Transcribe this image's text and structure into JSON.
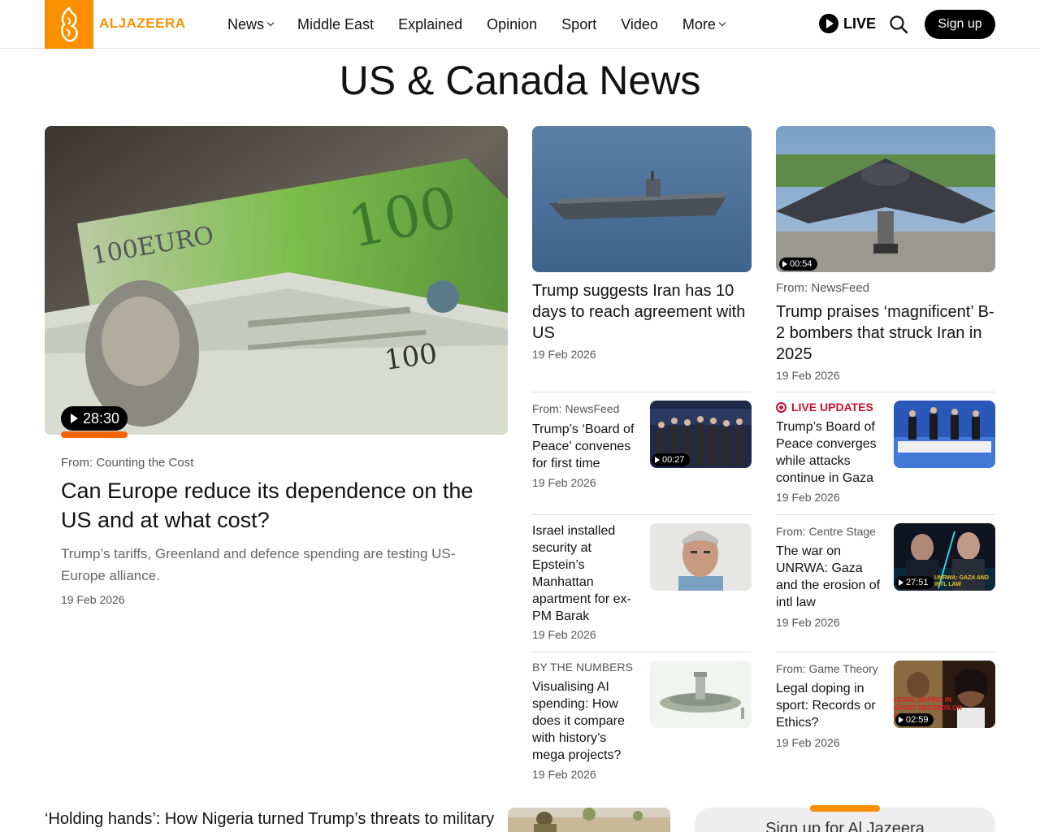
{
  "header": {
    "logo_text": "ALJAZEERA",
    "nav": [
      {
        "label": "News",
        "dropdown": true
      },
      {
        "label": "Middle East",
        "dropdown": false
      },
      {
        "label": "Explained",
        "dropdown": false
      },
      {
        "label": "Opinion",
        "dropdown": false
      },
      {
        "label": "Sport",
        "dropdown": false
      },
      {
        "label": "Video",
        "dropdown": false
      },
      {
        "label": "More",
        "dropdown": true
      }
    ],
    "live_label": "LIVE",
    "signup_label": "Sign up"
  },
  "page_title": "US & Canada News",
  "feature": {
    "duration": "28:30",
    "from": "From: Counting the Cost",
    "title": "Can Europe reduce its dependence on the US and at what cost?",
    "description": "Trump’s tariffs, Greenland and defence spending are testing US-Europe alliance.",
    "date": "19 Feb 2026"
  },
  "cards": {
    "iran": {
      "title": "Trump suggests Iran has 10 days to reach agreement with US",
      "date": "19 Feb 2026"
    },
    "b2": {
      "duration": "00:54",
      "from": "From: NewsFeed",
      "title": "Trump praises ‘magnificent’ B-2 bombers that struck Iran in 2025",
      "date": "19 Feb 2026"
    },
    "board": {
      "from": "From: NewsFeed",
      "title": "Trump’s ‘Board of Peace’ convenes for first time",
      "duration": "00:27",
      "date": "19 Feb 2026"
    },
    "liveupdates": {
      "tag": "LIVE UPDATES",
      "title": "Trump’s Board of Peace converges while attacks continue in Gaza",
      "date": "19 Feb 2026"
    },
    "epstein": {
      "title": "Israel installed security at Epstein’s Manhattan apartment for ex-PM Barak",
      "date": "19 Feb 2026"
    },
    "unrwa": {
      "from": "From: Centre Stage",
      "title": "The war on UNRWA: Gaza and the erosion of intl law",
      "duration": "27:51",
      "thumb_text": "UNRWA: GAZA AND INTL LAW",
      "date": "19 Feb 2026"
    },
    "ai": {
      "from": "BY THE NUMBERS",
      "title": "Visualising AI spending: How does it compare with history’s mega projects?",
      "date": "19 Feb 2026"
    },
    "doping": {
      "from": "From: Game Theory",
      "title": "Legal doping in sport: Records or Ethics?",
      "duration": "02:59",
      "thumb_text": "LEGAL DOPING IN SPORT RECORDS OR ETHICS?",
      "date": "19 Feb 2026"
    }
  },
  "bottom": {
    "title": "‘Holding hands’: How Nigeria turned Trump’s threats to military",
    "newsletter": "Sign up for Al Jazeera"
  }
}
